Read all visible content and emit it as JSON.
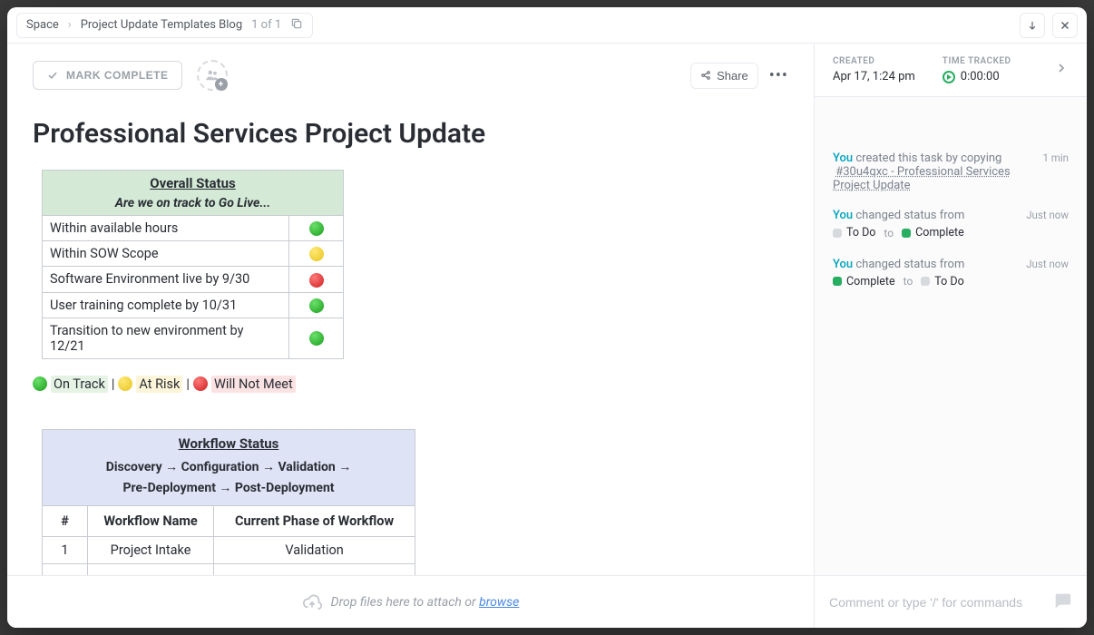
{
  "breadcrumb": {
    "space": "Space",
    "project": "Project Update Templates Blog",
    "count": "1 of 1"
  },
  "toolbar": {
    "mark_complete": "MARK COMPLETE",
    "share": "Share"
  },
  "title": "Professional Services Project Update",
  "overall": {
    "header": "Overall Status",
    "sub": "Are we on track to Go Live...",
    "rows": [
      {
        "label": "Within available hours",
        "color": "g"
      },
      {
        "label": "Within SOW Scope",
        "color": "y"
      },
      {
        "label": "Software Environment live by 9/30",
        "color": "r"
      },
      {
        "label": "User training complete by 10/31",
        "color": "g"
      },
      {
        "label": "Transition to new environment by 12/21",
        "color": "g"
      }
    ]
  },
  "legend": {
    "on_track": "On Track",
    "at_risk": "At Risk",
    "will_not": "Will Not Meet"
  },
  "workflow": {
    "header": "Workflow Status",
    "phases_line1": "Discovery   →   Configuration   →   Validation   →",
    "phases_line2": "Pre-Deployment   →   Post-Deployment",
    "col_num": "#",
    "col_name": "Workflow Name",
    "col_phase": "Current Phase of Workflow",
    "rows": [
      {
        "num": "1",
        "name": "Project Intake",
        "phase": "Validation"
      }
    ]
  },
  "meta": {
    "created_label": "CREATED",
    "created_value": "Apr 17, 1:24 pm",
    "time_label": "TIME TRACKED",
    "time_value": "0:00:00"
  },
  "activity": {
    "you": "You",
    "item1_text": "created this task by copying",
    "item1_link": "#30u4qxc - Professional Services Project Update",
    "item1_time": "1 min",
    "item2_text": "changed status from",
    "item2_time": "Just now",
    "todo": "To Do",
    "complete": "Complete",
    "to": "to",
    "item3_text": "changed status from",
    "item3_time": "Just now"
  },
  "footer": {
    "drop_text": "Drop files here to attach or ",
    "browse": "browse",
    "comment_placeholder": "Comment or type '/' for commands"
  }
}
